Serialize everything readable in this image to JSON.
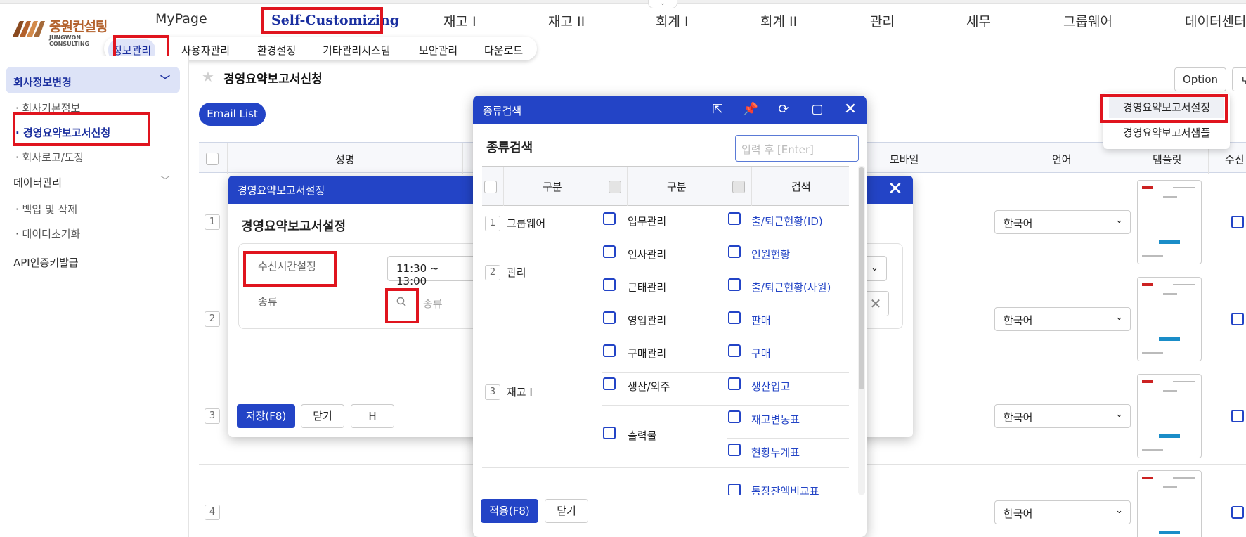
{
  "logo": {
    "name_ko": "중원컨설팅",
    "name_en": "JUNGWON CONSULTING"
  },
  "nav": [
    "MyPage",
    "Self-Customizing",
    "재고 I",
    "재고 II",
    "회계 I",
    "회계 II",
    "관리",
    "세무",
    "그룹웨어",
    "데이터센터"
  ],
  "subnav": [
    "정보관리",
    "사용자관리",
    "환경설정",
    "기타관리시스템",
    "보안관리",
    "다운로드"
  ],
  "sidebar": {
    "group1": "회사정보변경",
    "items1": [
      "회사기본정보",
      "경영요약보고서신청",
      "회사로고/도장"
    ],
    "group2": "데이터관리",
    "items2": [
      "백업 및 삭제",
      "데이터초기화"
    ],
    "group3": "API인증키발급"
  },
  "main": {
    "title": "경영요약보고서신청",
    "email_button": "Email List",
    "option_button": "Option",
    "option_button2": "모",
    "dropdown": [
      "경영요약보고서설정",
      "경영요약보고서샘플"
    ],
    "columns": [
      "성명",
      "모바일",
      "언어",
      "템플릿",
      "수신"
    ],
    "rows": [
      {
        "num": "1",
        "lang": "한국어"
      },
      {
        "num": "2",
        "lang": "한국어"
      },
      {
        "num": "3",
        "lang": "한국어"
      },
      {
        "num": "4",
        "lang": "한국어"
      }
    ]
  },
  "setting_dialog": {
    "bar_title": "경영요약보고서설정",
    "heading": "경영요약보고서설정",
    "label_time": "수신시간설정",
    "time_value": "11:30 ~ 13:00",
    "label_kind": "종류",
    "kind_placeholder": "종류",
    "save": "저장(F8)",
    "close": "닫기",
    "h": "H"
  },
  "kind_dialog": {
    "bar_title": "종류검색",
    "heading": "종류검색",
    "search_placeholder": "입력 후 [Enter]",
    "headers": [
      "구분",
      "구분",
      "검색"
    ],
    "groups": [
      {
        "num": "1",
        "name": "그룹웨어"
      },
      {
        "num": "2",
        "name": "관리"
      },
      {
        "num": "3",
        "name": "재고 I"
      }
    ],
    "subs": [
      "업무관리",
      "인사관리",
      "근태관리",
      "영업관리",
      "구매관리",
      "생산/외주",
      "출력물"
    ],
    "items": [
      "출/퇴근현황(ID)",
      "인원현황",
      "출/퇴근현황(사원)",
      "판매",
      "구매",
      "생산입고",
      "재고변동표",
      "현황누계표",
      "통장잔액비교표"
    ],
    "apply": "적용(F8)",
    "close": "닫기"
  }
}
